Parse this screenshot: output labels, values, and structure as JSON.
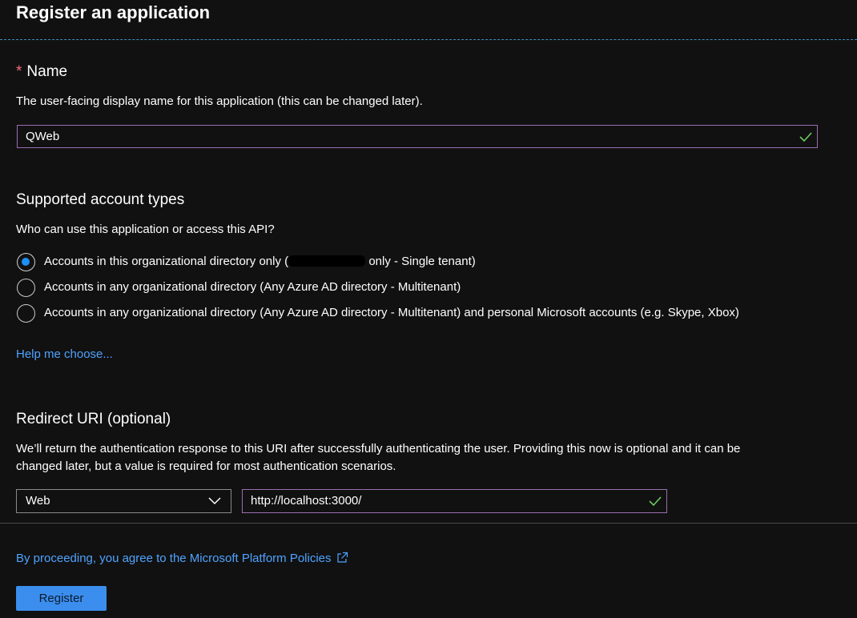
{
  "header": {
    "title": "Register an application"
  },
  "name_section": {
    "required_marker": "*",
    "title": "Name",
    "description": "The user-facing display name for this application (this can be changed later).",
    "input_value": "QWeb"
  },
  "account_types": {
    "title": "Supported account types",
    "question": "Who can use this application or access this API?",
    "options": [
      {
        "label_before": "Accounts in this organizational directory only (",
        "label_after": " only - Single tenant)",
        "selected": true
      },
      {
        "label": "Accounts in any organizational directory (Any Azure AD directory - Multitenant)",
        "selected": false
      },
      {
        "label": "Accounts in any organizational directory (Any Azure AD directory - Multitenant) and personal Microsoft accounts (e.g. Skype, Xbox)",
        "selected": false
      }
    ],
    "help_link": "Help me choose..."
  },
  "redirect": {
    "title": "Redirect URI (optional)",
    "description_line1": "We’ll return the authentication response to this URI after successfully authenticating the user. Providing this now is optional and it can be",
    "description_line2": "changed later, but a value is required for most authentication scenarios.",
    "platform_selected": "Web",
    "uri_value": "http://localhost:3000/"
  },
  "footer": {
    "policy_link": "By proceeding, you agree to the Microsoft Platform Policies",
    "register_label": "Register"
  },
  "icons": {
    "validation": "check-icon",
    "dropdown": "chevron-down-icon",
    "external": "external-link-icon"
  },
  "colors": {
    "background": "#111111",
    "accent": "#3b8eed",
    "link": "#4fa3ff",
    "required": "#f1707b",
    "valid_check": "#6ccb5f",
    "input_border": "#9a6fb0"
  }
}
